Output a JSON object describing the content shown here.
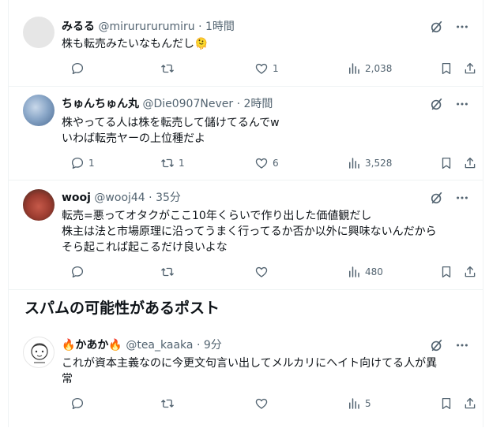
{
  "posts": [
    {
      "display_name": "みるる",
      "handle": "@mirurururumiru",
      "dot": "·",
      "time": "1時間",
      "text_lines": [
        "株も転売みたいなもんだし🫠"
      ],
      "replies": "",
      "reposts": "",
      "likes": "1",
      "views": "2,038",
      "avatar_color": "#e6e6e6"
    },
    {
      "display_name": "ちゅんちゅん丸",
      "handle": "@Die0907Never",
      "dot": "·",
      "time": "2時間",
      "text_lines": [
        "株やってる人は株を転売して儲けてるんでw",
        "いわば転売ヤーの上位種だよ"
      ],
      "replies": "1",
      "reposts": "1",
      "likes": "6",
      "views": "3,528",
      "avatar_color": "#8aa7c8"
    },
    {
      "display_name": "wooj",
      "handle": "@wooj44",
      "dot": "·",
      "time": "35分",
      "text_lines": [
        "転売=悪ってオタクがここ10年くらいで作り出した価値観だし",
        "株主は法と市場原理に沿ってうまく行ってるか否か以外に興味ないんだから",
        "そら起これば起こるだけ良いよな"
      ],
      "replies": "",
      "reposts": "",
      "likes": "",
      "views": "480",
      "avatar_color": "#9b3b2f"
    },
    {
      "display_name": "🔥かあか🔥",
      "handle": "@tea_kaaka",
      "dot": "·",
      "time": "9分",
      "text_lines": [
        "これが資本主義なのに今更文句言い出してメルカリにヘイト向けてる人が異",
        "常"
      ],
      "replies": "",
      "reposts": "",
      "likes": "",
      "views": "5",
      "avatar_color": "#ffffff"
    }
  ],
  "section": {
    "heading": "スパムの可能性があるポスト"
  },
  "colors": {
    "text": "#0f1419",
    "muted": "#536471",
    "border": "#eff3f4"
  }
}
